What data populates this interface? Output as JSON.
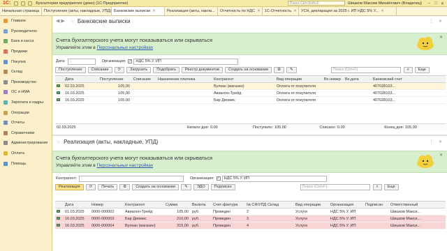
{
  "app": {
    "logo": "1С:",
    "title": "Бухгалтерия предприятия (демо)  (1С:Предприятие)",
    "search_placeholder": "Поиск Ctrl+Shift+F",
    "user": "Шишков Максим Михайлович (Владелец)"
  },
  "tabs": [
    {
      "label": "Начальная страница"
    },
    {
      "label": "Поступление (акты, накладные, УПД)"
    },
    {
      "label": "Банковские выписки"
    },
    {
      "label": "Реализация (акты, накла..."
    },
    {
      "label": "Отчетность по НДС"
    },
    {
      "label": "1С-Отчетность"
    },
    {
      "label": "УСН, декларация за 2025 г. ИП НДС 5% У..."
    }
  ],
  "sidebar": [
    {
      "label": "Главное",
      "color": "#e39c2e"
    },
    {
      "label": "Руководителю",
      "color": "#7b9fd1"
    },
    {
      "label": "Банк и касса",
      "color": "#6cae5e"
    },
    {
      "label": "Продажи",
      "color": "#e36c5a"
    },
    {
      "label": "Покупки",
      "color": "#5e95d1"
    },
    {
      "label": "Склад",
      "color": "#b58b58"
    },
    {
      "label": "Производство",
      "color": "#8c8c8c"
    },
    {
      "label": "ОС и НМА",
      "color": "#9a7ec9"
    },
    {
      "label": "Зарплата и кадры",
      "color": "#5eb3b0"
    },
    {
      "label": "Операции",
      "color": "#c9a24f"
    },
    {
      "label": "Отчеты",
      "color": "#6d8fc2"
    },
    {
      "label": "Справочники",
      "color": "#b0805e"
    },
    {
      "label": "Администрирование",
      "color": "#8c8c8c"
    },
    {
      "label": "Оплата",
      "color": "#e3b52e"
    },
    {
      "label": "Помощь",
      "color": "#5e95d1"
    }
  ],
  "bank": {
    "title": "Банковские выписки",
    "banner_line1": "Счета бухгалтерского учета могут показываться или скрываться",
    "banner_line2_prefix": "Управляйте этим в ",
    "banner_link": "Персональных настройках",
    "date_label": "Дата:",
    "date_value": "..",
    "org_label": "Организация:",
    "org_value": "НДС 5% У. ИП",
    "buttons": {
      "receipt": "Поступление",
      "writeoff": "Списание",
      "load": "Загрузить",
      "pick": "Подобрать",
      "registry": "Реестр документов",
      "create_based": "Создать на основании",
      "more": "Еще"
    },
    "search_placeholder": "Поиск (Ctrl+F)",
    "columns": [
      "Дата",
      "Поступление",
      "Списание",
      "Назначение платежа",
      "Контрагент",
      "Вид операции",
      "Вх.номер",
      "Вх.дата",
      "Банковский счет"
    ],
    "rows": [
      [
        "02.03.2025",
        "105,00",
        "",
        "",
        "Вулкан (магазин)",
        "Оплата от покупателя",
        "",
        "",
        "407028103..."
      ],
      [
        "16.03.2025",
        "105,00",
        "",
        "",
        "Авиалон-Трейд",
        "Оплата от покупателя",
        "",
        "",
        "407028103..."
      ],
      [
        "16.03.2025",
        "105,00",
        "",
        "",
        "Бар Диомис",
        "Оплата от покупателя",
        "",
        "",
        "407028103..."
      ]
    ],
    "footer": {
      "date": "02.03.2025",
      "start_label": "Начало дня:",
      "start_value": "0.00",
      "in_label": "Поступило:",
      "in_value": "105,00",
      "out_label": "Списано:",
      "out_value": "0.00",
      "end_label": "Конец дня:",
      "end_value": "105,00"
    }
  },
  "sales": {
    "title": "Реализация (акты, накладные, УПД)",
    "banner_line1": "Счета бухгалтерского учета могут показываться или скрываться",
    "banner_line2_prefix": "Управляйте этим в ",
    "banner_link": "Персональных настройках",
    "contractor_label": "Контрагент:",
    "org_label": "Организация:",
    "org_value": "НДС 5% У. ИП",
    "buttons": {
      "realization": "Реализация",
      "print": "Печать",
      "create_based": "Создать на основании",
      "edo": "ЭДО",
      "sign": "Подписан",
      "more": "Еще"
    },
    "search_placeholder": "Поиск (Ctrl+F)",
    "columns": [
      "Дата",
      "Номер",
      "Контрагент",
      "Сумма",
      "Валюта",
      "Счет-фактура",
      "№ СФ/УПД",
      "Склад",
      "Вид операции",
      "Организация",
      "Подписан",
      "Ответственный"
    ],
    "rows": [
      [
        "01.03.2025",
        "0000-000002",
        "Авиалон-Трейд",
        "105,00",
        "руб.",
        "Проведен",
        "2",
        "",
        "Услуги",
        "НДС 5% У. ИП",
        "",
        "Шишков Макси..."
      ],
      [
        "16.03.2025",
        "0000-000003",
        "Бар Диомис",
        "210,00",
        "руб.",
        "Проведен",
        "3",
        "",
        "Услуги",
        "НДС 5% У. ИП",
        "",
        "Шишков Макси..."
      ],
      [
        "16.03.2025",
        "0000-000004",
        "Вулкан (магазин)",
        "315,00",
        "руб.",
        "Проведен",
        "4",
        "",
        "Услуги",
        "НДС 5% У. ИП",
        "",
        "Шишков Макси..."
      ]
    ]
  }
}
